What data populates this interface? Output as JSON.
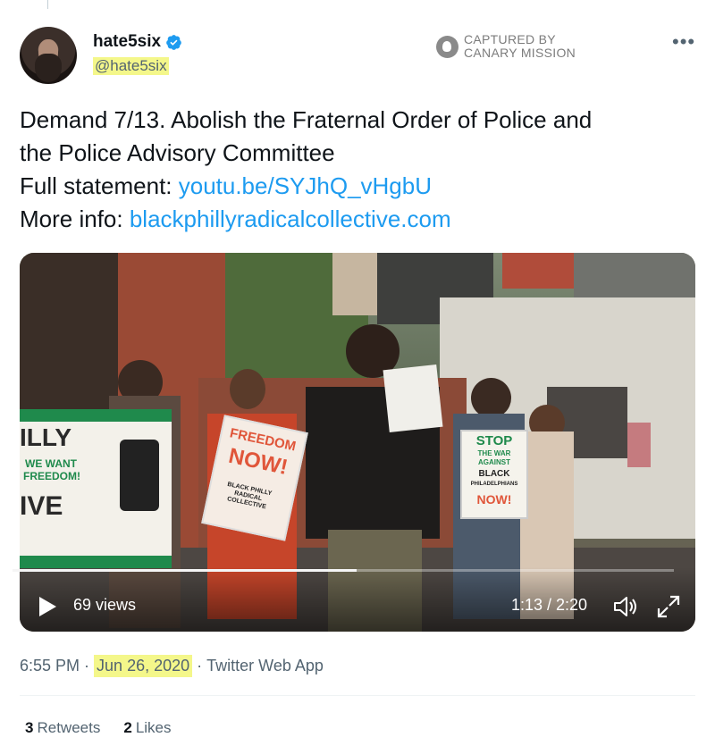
{
  "author": {
    "display_name": "hate5six",
    "handle": "@hate5six",
    "verified": true
  },
  "watermark": {
    "line1": "CAPTURED BY",
    "line2": "CANARY MISSION"
  },
  "more_icon": "more-dots-icon",
  "tweet": {
    "line1": "Demand 7/13. Abolish the Fraternal Order of Police and",
    "line2": "the Police Advisory Committee",
    "full_statement_label": "Full statement: ",
    "full_statement_link": "youtu.be/SYJhQ_vHgbU",
    "more_info_label": "More info: ",
    "more_info_link": "blackphillyradicalcollective.com"
  },
  "video": {
    "views": "69 views",
    "time": "1:13 / 2:20",
    "progress": 0.52,
    "signs": {
      "banner_top": "ILLY",
      "banner_mid1": "WE WANT",
      "banner_mid2": "FREEDOM!",
      "banner_bottom": "IVE",
      "freedom1": "FREEDOM",
      "freedom2": "NOW!",
      "freedom_small": "BLACK PHILLY RADICAL COLLECTIVE",
      "stop1": "STOP",
      "stop2": "THE WAR",
      "stop3": "AGAINST",
      "stop4": "BLACK",
      "stop5": "PHILADELPHIANS",
      "stop6": "NOW!"
    }
  },
  "timestamp": {
    "time": "6:55 PM",
    "separator": " · ",
    "date": "Jun 26, 2020",
    "source_separator": " · ",
    "source": "Twitter Web App"
  },
  "stats": {
    "retweets_count": "3",
    "retweets_label": "Retweets",
    "likes_count": "2",
    "likes_label": "Likes"
  },
  "colors": {
    "link": "#1d9bf0",
    "highlight": "#f4f78a",
    "secondary_text": "#536471"
  }
}
